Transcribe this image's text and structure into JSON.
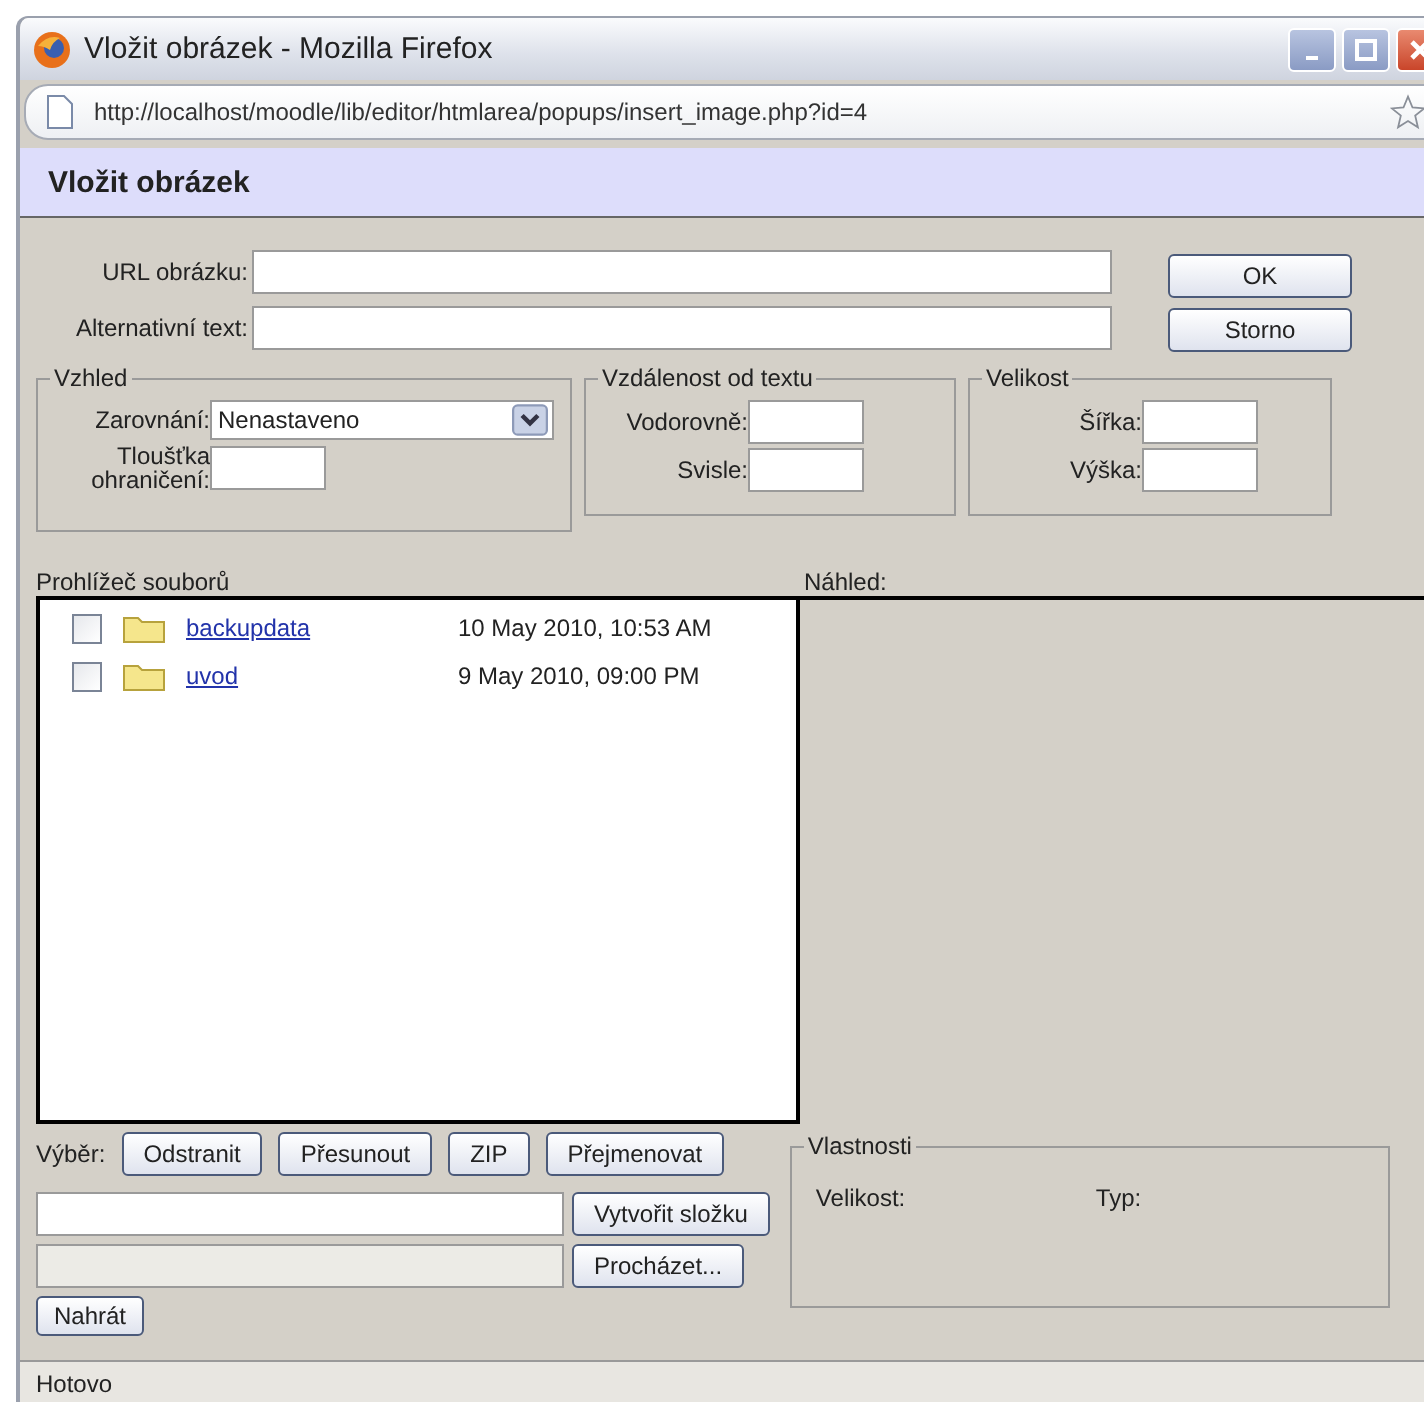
{
  "window": {
    "title": "Vložit obrázek - Mozilla Firefox"
  },
  "address_bar": {
    "url": "http://localhost/moodle/lib/editor/htmlarea/popups/insert_image.php?id=4"
  },
  "dialog": {
    "title": "Vložit obrázek"
  },
  "fields": [
    {
      "label": "URL obrázku:"
    },
    {
      "label": "Alternativní text:"
    }
  ],
  "buttons": [
    "OK",
    "Storno"
  ],
  "appearance": {
    "legend": "Vzhled",
    "alignment": {
      "label": "Zarovnání:",
      "value": "Nenastaveno"
    },
    "border": {
      "label": "Tloušťka ohraničení:"
    }
  },
  "spacing": {
    "legend": "Vzdálenost od textu",
    "fields": [
      {
        "label": "Vodorovně:"
      },
      {
        "label": "Svisle:"
      }
    ]
  },
  "size": {
    "legend": "Velikost",
    "fields": [
      {
        "label": "Šířka:"
      },
      {
        "label": "Výška:"
      }
    ]
  },
  "file_browser": {
    "title": "Prohlížeč souborů",
    "files": [
      {
        "name": "backupdata",
        "date": "10 May 2010, 10:53 AM",
        "checked": false
      },
      {
        "name": "uvod",
        "date": "9 May 2010, 09:00 PM",
        "checked": false
      }
    ]
  },
  "preview": {
    "title": "Náhled:"
  },
  "selection": {
    "label": "Výběr:",
    "buttons": [
      "Odstranit",
      "Přesunout",
      "ZIP",
      "Přejmenovat"
    ]
  },
  "properties": {
    "legend": "Vlastnosti",
    "fields": [
      "Velikost:",
      "Typ:"
    ]
  },
  "create_folder_button": "Vytvořit složku",
  "browse_button": "Procházet...",
  "upload_button": "Nahrát",
  "status_bar": "Hotovo"
}
